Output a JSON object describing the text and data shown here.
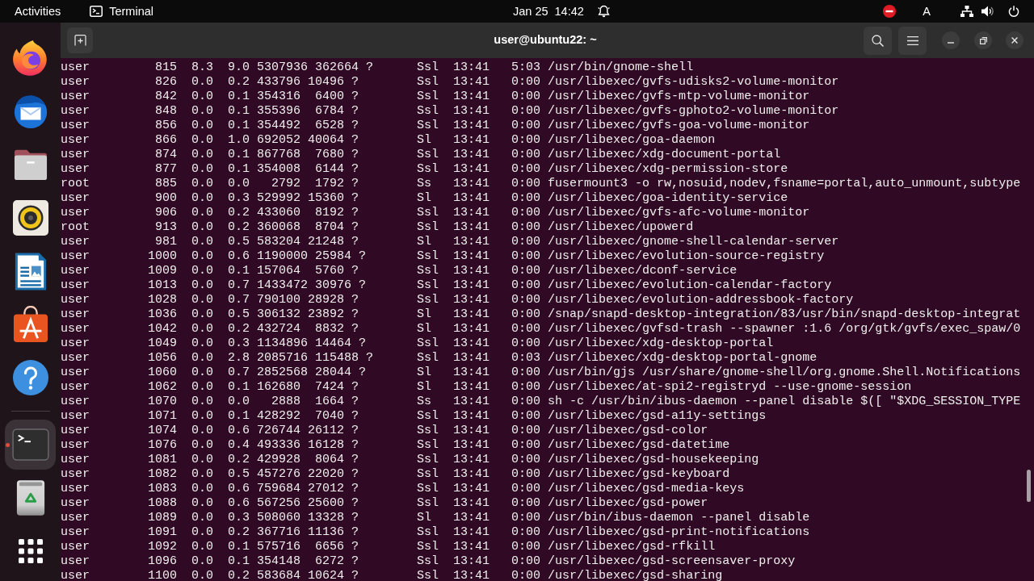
{
  "top_bar": {
    "activities": "Activities",
    "app_menu": "Terminal",
    "clock": {
      "date": "Jan 25",
      "time": "14:42"
    },
    "input_source": "A"
  },
  "dock": {
    "favorites": [
      {
        "kind": "browser",
        "running": false,
        "selected": false
      },
      {
        "kind": "mail",
        "running": false,
        "selected": false
      },
      {
        "kind": "files",
        "running": false,
        "selected": false
      },
      {
        "kind": "music",
        "running": false,
        "selected": false
      },
      {
        "kind": "documents",
        "running": false,
        "selected": false
      },
      {
        "kind": "store",
        "running": false,
        "selected": false
      },
      {
        "kind": "help",
        "running": false,
        "selected": false
      }
    ],
    "others": [
      {
        "kind": "terminal",
        "running": true,
        "selected": true
      },
      {
        "kind": "trash",
        "running": false,
        "selected": false
      }
    ]
  },
  "window": {
    "title": "user@ubuntu22: ~"
  },
  "terminal": {
    "lines": [
      "user         815  8.3  9.0 5307936 362664 ?      Ssl  13:41   5:03 /usr/bin/gnome-shell",
      "user         826  0.0  0.2 433796 10496 ?        Ssl  13:41   0:00 /usr/libexec/gvfs-udisks2-volume-monitor",
      "user         842  0.0  0.1 354316  6400 ?        Ssl  13:41   0:00 /usr/libexec/gvfs-mtp-volume-monitor",
      "user         848  0.0  0.1 355396  6784 ?        Ssl  13:41   0:00 /usr/libexec/gvfs-gphoto2-volume-monitor",
      "user         856  0.0  0.1 354492  6528 ?        Ssl  13:41   0:00 /usr/libexec/gvfs-goa-volume-monitor",
      "user         866  0.0  1.0 692052 40064 ?        Sl   13:41   0:00 /usr/libexec/goa-daemon",
      "user         874  0.0  0.1 867768  7680 ?        Ssl  13:41   0:00 /usr/libexec/xdg-document-portal",
      "user         877  0.0  0.1 354008  6144 ?        Ssl  13:41   0:00 /usr/libexec/xdg-permission-store",
      "root         885  0.0  0.0   2792  1792 ?        Ss   13:41   0:00 fusermount3 -o rw,nosuid,nodev,fsname=portal,auto_unmount,subtype",
      "user         900  0.0  0.3 529992 15360 ?        Sl   13:41   0:00 /usr/libexec/goa-identity-service",
      "user         906  0.0  0.2 433060  8192 ?        Ssl  13:41   0:00 /usr/libexec/gvfs-afc-volume-monitor",
      "root         913  0.0  0.2 360068  8704 ?        Ssl  13:41   0:00 /usr/libexec/upowerd",
      "user         981  0.0  0.5 583204 21248 ?        Sl   13:41   0:00 /usr/libexec/gnome-shell-calendar-server",
      "user        1000  0.0  0.6 1190000 25984 ?       Ssl  13:41   0:00 /usr/libexec/evolution-source-registry",
      "user        1009  0.0  0.1 157064  5760 ?        Ssl  13:41   0:00 /usr/libexec/dconf-service",
      "user        1013  0.0  0.7 1433472 30976 ?       Ssl  13:41   0:00 /usr/libexec/evolution-calendar-factory",
      "user        1028  0.0  0.7 790100 28928 ?        Ssl  13:41   0:00 /usr/libexec/evolution-addressbook-factory",
      "user        1036  0.0  0.5 306132 23892 ?        Sl   13:41   0:00 /snap/snapd-desktop-integration/83/usr/bin/snapd-desktop-integrat",
      "user        1042  0.0  0.2 432724  8832 ?        Sl   13:41   0:00 /usr/libexec/gvfsd-trash --spawner :1.6 /org/gtk/gvfs/exec_spaw/0",
      "user        1049  0.0  0.3 1134896 14464 ?       Ssl  13:41   0:00 /usr/libexec/xdg-desktop-portal",
      "user        1056  0.0  2.8 2085716 115488 ?      Ssl  13:41   0:03 /usr/libexec/xdg-desktop-portal-gnome",
      "user        1060  0.0  0.7 2852568 28044 ?       Sl   13:41   0:00 /usr/bin/gjs /usr/share/gnome-shell/org.gnome.Shell.Notifications",
      "user        1062  0.0  0.1 162680  7424 ?        Sl   13:41   0:00 /usr/libexec/at-spi2-registryd --use-gnome-session",
      "user        1070  0.0  0.0   2888  1664 ?        Ss   13:41   0:00 sh -c /usr/bin/ibus-daemon --panel disable $([ \"$XDG_SESSION_TYPE",
      "user        1071  0.0  0.1 428292  7040 ?        Ssl  13:41   0:00 /usr/libexec/gsd-a11y-settings",
      "user        1074  0.0  0.6 726744 26112 ?        Ssl  13:41   0:00 /usr/libexec/gsd-color",
      "user        1076  0.0  0.4 493336 16128 ?        Ssl  13:41   0:00 /usr/libexec/gsd-datetime",
      "user        1081  0.0  0.2 429928  8064 ?        Ssl  13:41   0:00 /usr/libexec/gsd-housekeeping",
      "user        1082  0.0  0.5 457276 22020 ?        Ssl  13:41   0:00 /usr/libexec/gsd-keyboard",
      "user        1083  0.0  0.6 759684 27012 ?        Ssl  13:41   0:00 /usr/libexec/gsd-media-keys",
      "user        1088  0.0  0.6 567256 25600 ?        Ssl  13:41   0:00 /usr/libexec/gsd-power",
      "user        1089  0.0  0.3 508060 13328 ?        Sl   13:41   0:00 /usr/bin/ibus-daemon --panel disable",
      "user        1091  0.0  0.2 367716 11136 ?        Ssl  13:41   0:00 /usr/libexec/gsd-print-notifications",
      "user        1092  0.0  0.1 575716  6656 ?        Ssl  13:41   0:00 /usr/libexec/gsd-rfkill",
      "user        1096  0.0  0.1 354148  6272 ?        Ssl  13:41   0:00 /usr/libexec/gsd-screensaver-proxy",
      "user        1100  0.0  0.2 583684 10624 ?        Ssl  13:41   0:00 /usr/libexec/gsd-sharing"
    ]
  }
}
